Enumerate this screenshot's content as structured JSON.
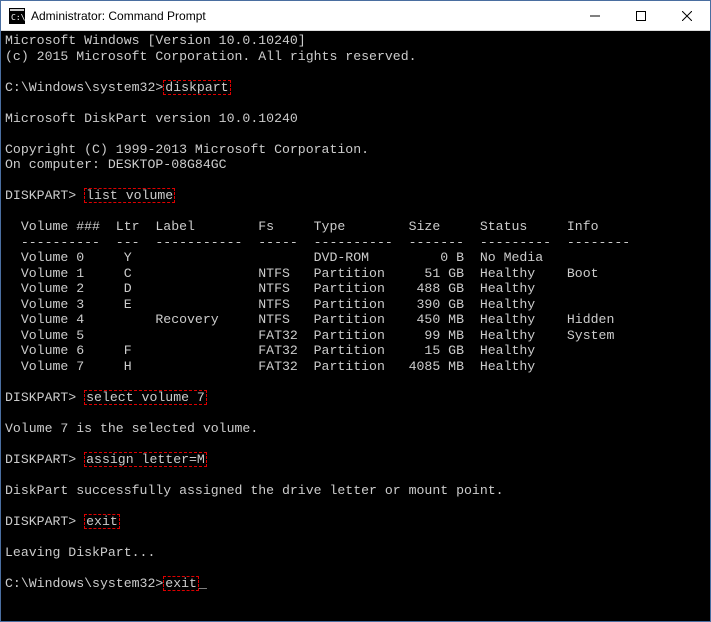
{
  "title": "Administrator: Command Prompt",
  "lines": {
    "l1": "Microsoft Windows [Version 10.0.10240]",
    "l2": "(c) 2015 Microsoft Corporation. All rights reserved.",
    "prompt_sys": "C:\\Windows\\system32>",
    "cmd_diskpart": "diskpart",
    "dp_ver": "Microsoft DiskPart version 10.0.10240",
    "copyright": "Copyright (C) 1999-2013 Microsoft Corporation.",
    "on_computer": "On computer: DESKTOP-08G84GC",
    "prompt_dp": "DISKPART> ",
    "cmd_list": "list volume",
    "header": "  Volume ###  Ltr  Label        Fs     Type        Size     Status     Info",
    "divider": "  ----------  ---  -----------  -----  ----------  -------  ---------  --------",
    "v0": "  Volume 0     Y                       DVD-ROM         0 B  No Media",
    "v1": "  Volume 1     C                NTFS   Partition     51 GB  Healthy    Boot",
    "v2": "  Volume 2     D                NTFS   Partition    488 GB  Healthy",
    "v3": "  Volume 3     E                NTFS   Partition    390 GB  Healthy",
    "v4": "  Volume 4         Recovery     NTFS   Partition    450 MB  Healthy    Hidden",
    "v5": "  Volume 5                      FAT32  Partition     99 MB  Healthy    System",
    "v6": "  Volume 6     F                FAT32  Partition     15 GB  Healthy",
    "v7": "  Volume 7     H                FAT32  Partition   4085 MB  Healthy",
    "cmd_select": "select volume 7",
    "sel_result": "Volume 7 is the selected volume.",
    "cmd_assign": "assign letter=M",
    "assign_result": "DiskPart successfully assigned the drive letter or mount point.",
    "cmd_exit": "exit",
    "leaving": "Leaving DiskPart...",
    "cmd_exit2": "exit"
  },
  "cursor": "_"
}
